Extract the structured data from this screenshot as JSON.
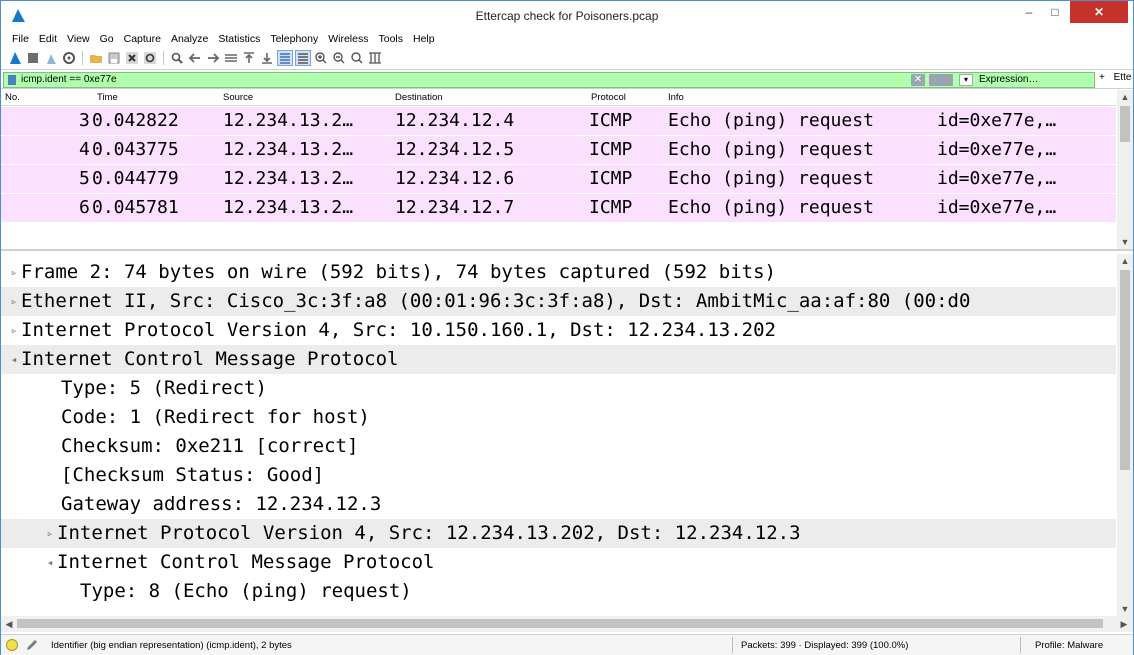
{
  "window": {
    "title": "Ettercap check for Poisoners.pcap",
    "min_glyph": "–",
    "max_glyph": "□",
    "close_glyph": "✕"
  },
  "menu": [
    "File",
    "Edit",
    "View",
    "Go",
    "Capture",
    "Analyze",
    "Statistics",
    "Telephony",
    "Wireless",
    "Tools",
    "Help"
  ],
  "toolbar": {
    "icons": [
      "start-capture-icon",
      "stop-capture-icon",
      "restart-capture-icon",
      "capture-options-icon",
      "open-file-icon",
      "save-file-icon",
      "close-file-icon",
      "reload-file-icon",
      "find-packet-icon",
      "go-back-icon",
      "go-forward-icon",
      "go-to-packet-icon",
      "first-packet-icon",
      "last-packet-icon",
      "autoscroll-icon",
      "colorize-icon",
      "zoom-in-icon",
      "zoom-out-icon",
      "normal-size-icon",
      "resize-columns-icon"
    ]
  },
  "filter": {
    "value": "icmp.ident == 0xe77e",
    "expression_label": "Expression…",
    "plus_label": "+",
    "extra_label": "Ette",
    "clear_glyph": "✕",
    "dropdown_glyph": "▾"
  },
  "packet_list": {
    "columns": [
      "No.",
      "Time",
      "Source",
      "Destination",
      "Protocol",
      "Info"
    ],
    "rows": [
      {
        "no": "3",
        "time": "0.042822",
        "source": "12.234.13.2…",
        "destination": "12.234.12.4",
        "protocol": "ICMP",
        "info": "Echo (ping) request",
        "extra": "id=0xe77e,…"
      },
      {
        "no": "4",
        "time": "0.043775",
        "source": "12.234.13.2…",
        "destination": "12.234.12.5",
        "protocol": "ICMP",
        "info": "Echo (ping) request",
        "extra": "id=0xe77e,…"
      },
      {
        "no": "5",
        "time": "0.044779",
        "source": "12.234.13.2…",
        "destination": "12.234.12.6",
        "protocol": "ICMP",
        "info": "Echo (ping) request",
        "extra": "id=0xe77e,…"
      },
      {
        "no": "6",
        "time": "0.045781",
        "source": "12.234.13.2…",
        "destination": "12.234.12.7",
        "protocol": "ICMP",
        "info": "Echo (ping) request",
        "extra": "id=0xe77e,…"
      }
    ],
    "row_color": "#fce0ff"
  },
  "details": {
    "lines": [
      {
        "text": "Frame 2: 74 bytes on wire (592 bits), 74 bytes captured (592 bits)",
        "expander": "▹"
      },
      {
        "text": "Ethernet II, Src: Cisco_3c:3f:a8 (00:01:96:3c:3f:a8), Dst: AmbitMic_aa:af:80 (00:d0",
        "expander": "▹"
      },
      {
        "text": "Internet Protocol Version 4, Src: 10.150.160.1, Dst: 12.234.13.202",
        "expander": "▹"
      },
      {
        "text": "Internet Control Message Protocol",
        "expander": "◂"
      },
      {
        "text": "Type: 5 (Redirect)",
        "expander": ""
      },
      {
        "text": "Code: 1 (Redirect for host)",
        "expander": ""
      },
      {
        "text": "Checksum: 0xe211 [correct]",
        "expander": ""
      },
      {
        "text": "[Checksum Status: Good]",
        "expander": ""
      },
      {
        "text": "Gateway address: 12.234.12.3",
        "expander": ""
      },
      {
        "text": "Internet Protocol Version 4, Src: 12.234.13.202, Dst: 12.234.12.3",
        "expander": "▹"
      },
      {
        "text": "Internet Control Message Protocol",
        "expander": "◂"
      },
      {
        "text": "Type: 8 (Echo (ping) request)",
        "expander": ""
      }
    ]
  },
  "status": {
    "field_info": "Identifier (big endian representation) (icmp.ident), 2 bytes",
    "packets": "Packets: 399 · Displayed: 399 (100.0%)",
    "profile": "Profile: Malware"
  }
}
